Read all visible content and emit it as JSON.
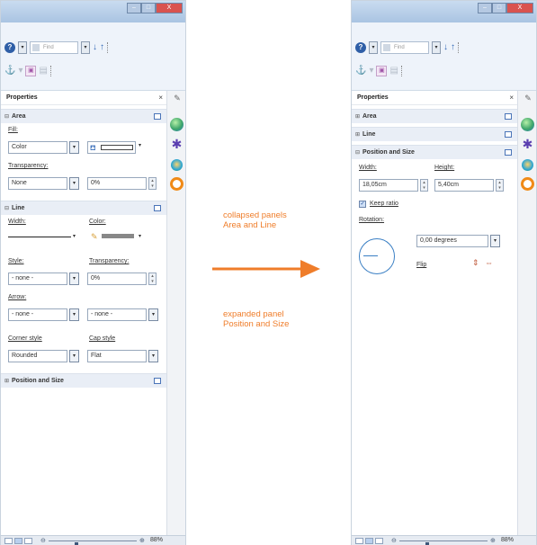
{
  "toolbar": {
    "help_label": "?",
    "find_placeholder": "Find",
    "dropdown_arrow": "▾",
    "find_next_icon": "↓",
    "find_prev_icon": "↑"
  },
  "titlebar": {
    "min": "–",
    "max": "□",
    "close": "X"
  },
  "panel": {
    "title": "Properties",
    "close": "×"
  },
  "left": {
    "area": {
      "label": "Area",
      "fill_label": "Fill:",
      "fill_value": "Color",
      "transparency_label": "Transparency:",
      "transparency_type": "None",
      "transparency_percent": "0%"
    },
    "line": {
      "label": "Line",
      "width_label": "Width:",
      "color_label": "Color:",
      "style_label": "Style:",
      "style_value": "- none -",
      "line_transparency_label": "Transparency:",
      "line_transparency_value": "0%",
      "arrow_label": "Arrow:",
      "arrow_start": "- none -",
      "arrow_end": "- none -",
      "corner_style_label": "Corner style",
      "corner_style_value": "Rounded",
      "cap_style_label": "Cap style",
      "cap_style_value": "Flat"
    },
    "position_size": {
      "label": "Position and Size"
    }
  },
  "right": {
    "area_label": "Area",
    "line_label": "Line",
    "position_size": {
      "label": "Position and Size",
      "width_label": "Width:",
      "width_value": "18,05cm",
      "height_label": "Height:",
      "height_value": "5,40cm",
      "keep_ratio_label": "Keep ratio",
      "keep_ratio_checked": true,
      "rotation_label": "Rotation:",
      "rotation_value": "0,00 degrees",
      "flip_label": "Flip"
    }
  },
  "statusbar": {
    "zoom_level": "88%",
    "zoom_fraction": 0.3
  },
  "callouts": {
    "collapsed": [
      "collapsed panels",
      "Area and Line"
    ],
    "expanded": [
      "expanded panel",
      "Position and Size"
    ]
  },
  "colors": {
    "accent": "#ef7d2a",
    "section_header": "#e9eef6",
    "title_gradient_top": "#c9dcf0"
  }
}
